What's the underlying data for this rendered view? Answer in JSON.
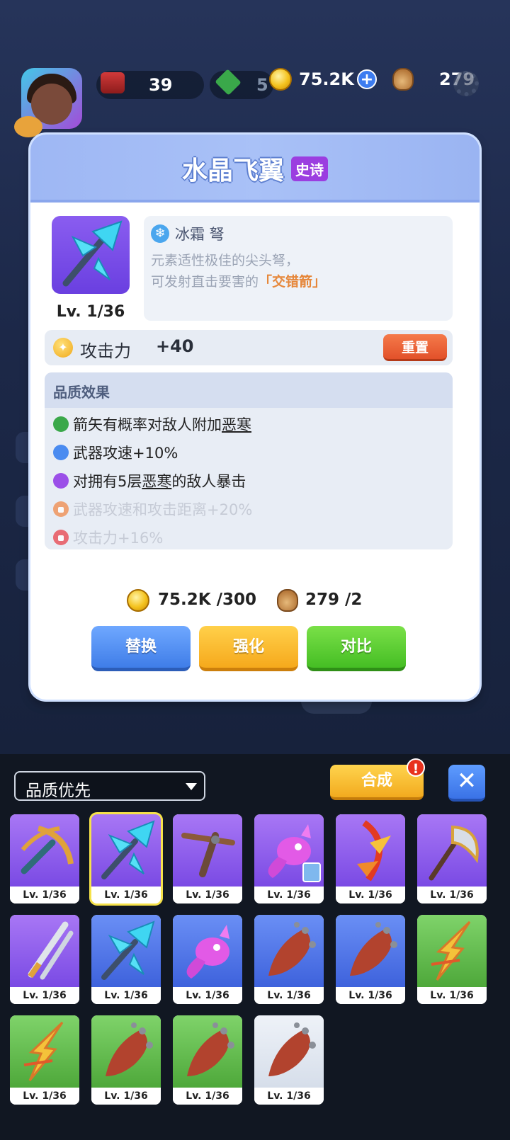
{
  "resources": {
    "books": "39",
    "gems": "5",
    "coins": "75.2K",
    "bags": "279"
  },
  "dialog": {
    "title": "水晶飞翼",
    "rarity": "史诗",
    "level": "Lv. 1/36",
    "weapon_type": "冰霜 弩",
    "description_line1": "元素适性极佳的尖头弩，",
    "description_line2_prefix": "可发射直击要害的",
    "description_line2_highlight": "「交错箭」",
    "attack_label": "攻击力",
    "attack_value": "+40",
    "reset_label": "重置",
    "quality_title": "品质效果",
    "effects": [
      {
        "prefix": "箭矢有概率对敌人附加",
        "underlined": "恶寒",
        "suffix": "",
        "color": "#3aa84a",
        "locked": false
      },
      {
        "prefix": "武器攻速+10%",
        "underlined": "",
        "suffix": "",
        "color": "#4a8bf0",
        "locked": false
      },
      {
        "prefix": "对拥有5层",
        "underlined": "恶寒",
        "suffix": "的敌人暴击",
        "color": "#9b4fe8",
        "locked": false
      },
      {
        "prefix": "武器攻速和攻击距离+20%",
        "underlined": "",
        "suffix": "",
        "color": "#f08a4a",
        "locked": true
      },
      {
        "prefix": "攻击力+16%",
        "underlined": "",
        "suffix": "",
        "color": "#e8404a",
        "locked": true
      }
    ],
    "cost_coins": "75.2K /300",
    "cost_bags": "279 /2",
    "buttons": {
      "replace": "替换",
      "upgrade": "强化",
      "compare": "对比"
    }
  },
  "inventory": {
    "sort_label": "品质优先",
    "synth_label": "合成",
    "alert": "!",
    "close": "✕",
    "items": [
      {
        "level": "Lv. 1/36",
        "bg": "purple",
        "icon": "crossbow-gold-icon"
      },
      {
        "level": "Lv. 1/36",
        "bg": "purple",
        "icon": "crystal-crossbow-icon",
        "selected": true
      },
      {
        "level": "Lv. 1/36",
        "bg": "purple",
        "icon": "crossbow-wood-icon"
      },
      {
        "level": "Lv. 1/36",
        "bg": "purple",
        "icon": "pink-dragon-icon",
        "hero": true
      },
      {
        "level": "Lv. 1/36",
        "bg": "purple",
        "icon": "fire-bow-icon"
      },
      {
        "level": "Lv. 1/36",
        "bg": "purple",
        "icon": "golden-axe-icon"
      },
      {
        "level": "Lv. 1/36",
        "bg": "purple",
        "icon": "twin-daggers-icon"
      },
      {
        "level": "Lv. 1/36",
        "bg": "blue",
        "icon": "crystal-crossbow-icon"
      },
      {
        "level": "Lv. 1/36",
        "bg": "blue",
        "icon": "pink-dragon-icon"
      },
      {
        "level": "Lv. 1/36",
        "bg": "blue",
        "icon": "spiked-club-icon"
      },
      {
        "level": "Lv. 1/36",
        "bg": "blue",
        "icon": "spiked-club-icon"
      },
      {
        "level": "Lv. 1/36",
        "bg": "green",
        "icon": "lightning-bolt-icon"
      },
      {
        "level": "Lv. 1/36",
        "bg": "green",
        "icon": "lightning-bolt-icon"
      },
      {
        "level": "Lv. 1/36",
        "bg": "green",
        "icon": "spiked-club-icon"
      },
      {
        "level": "Lv. 1/36",
        "bg": "green",
        "icon": "spiked-club-icon"
      },
      {
        "level": "Lv. 1/36",
        "bg": "white",
        "icon": "spiked-club-icon"
      }
    ]
  }
}
